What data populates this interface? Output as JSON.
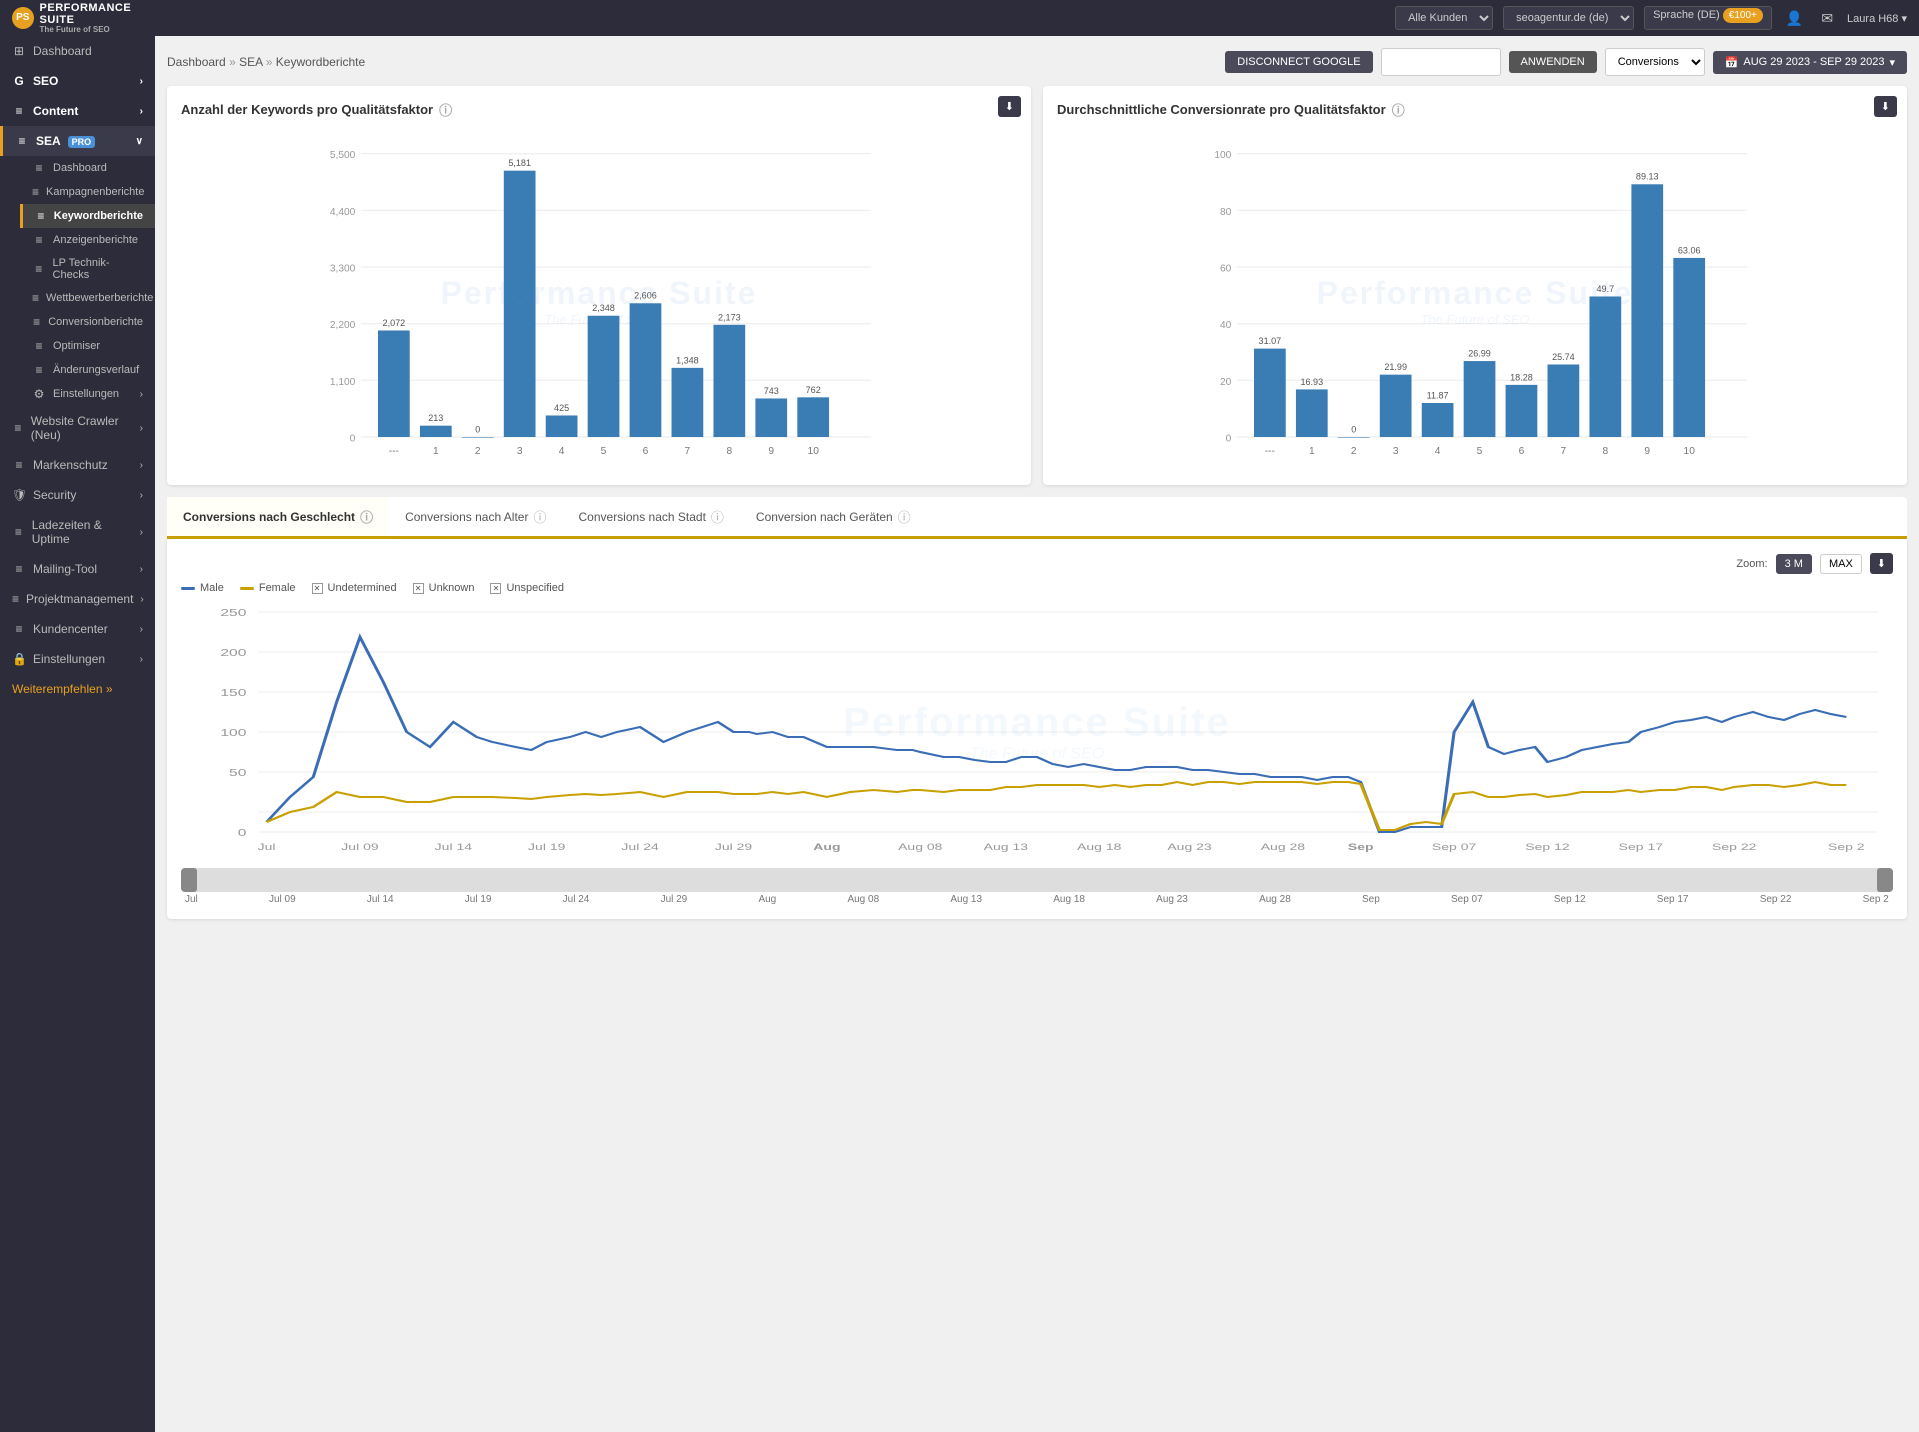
{
  "app": {
    "name": "PerforMance Suite",
    "tagline": "The Future of SEO"
  },
  "topnav": {
    "customer_label": "Alle Kunden",
    "agency_label": "seoagentur.de (de)",
    "language_label": "Sprache (DE)",
    "lang_badge": "€100+",
    "user_name": "Laura H68 ▾"
  },
  "breadcrumb": {
    "items": [
      "Dashboard",
      "SEA",
      "Keywordberichte"
    ],
    "separator": "»"
  },
  "toolbar": {
    "disconnect_label": "DISCONNECT GOOGLE",
    "apply_label": "ANWENDEN",
    "search_placeholder": "",
    "dropdown_options": [
      "Conversions"
    ],
    "dropdown_value": "Conversions",
    "date_range": "AUG 29 2023 - SEP 29 2023",
    "calendar_icon": "📅"
  },
  "sidebar": {
    "logo_icon": "PS",
    "items": [
      {
        "id": "dashboard",
        "label": "Dashboard",
        "icon": "⊞",
        "level": 0,
        "active": false
      },
      {
        "id": "seo",
        "label": "SEO",
        "icon": "G",
        "level": 0,
        "active": false,
        "hasArrow": true
      },
      {
        "id": "content",
        "label": "Content",
        "icon": "≡",
        "level": 0,
        "active": false,
        "hasArrow": true
      },
      {
        "id": "sea",
        "label": "SEA",
        "icon": "≡",
        "level": 0,
        "active": true,
        "hasArrow": true,
        "badge": "PRO"
      },
      {
        "id": "sea-dashboard",
        "label": "Dashboard",
        "icon": "≡",
        "level": 1,
        "active": false
      },
      {
        "id": "kampagnenberichte",
        "label": "Kampagnenberichte",
        "icon": "≡",
        "level": 1,
        "active": false
      },
      {
        "id": "keywordberichte",
        "label": "Keywordberichte",
        "icon": "≡",
        "level": 1,
        "active": true
      },
      {
        "id": "anzeigenberichte",
        "label": "Anzeigenberichte",
        "icon": "≡",
        "level": 1,
        "active": false
      },
      {
        "id": "lp-technik",
        "label": "LP Technik-Checks",
        "icon": "≡",
        "level": 1,
        "active": false
      },
      {
        "id": "wettbewerber",
        "label": "Wettbewerberberichte",
        "icon": "≡",
        "level": 1,
        "active": false
      },
      {
        "id": "conversionberichte",
        "label": "Conversionberichte",
        "icon": "≡",
        "level": 1,
        "active": false
      },
      {
        "id": "optimiser",
        "label": "Optimiser",
        "icon": "≡",
        "level": 1,
        "active": false
      },
      {
        "id": "aenderungsverlauf",
        "label": "Änderungsverlauf",
        "icon": "≡",
        "level": 1,
        "active": false
      },
      {
        "id": "einstellungen-sea",
        "label": "Einstellungen",
        "icon": "⚙",
        "level": 1,
        "active": false
      },
      {
        "id": "website-crawler",
        "label": "Website Crawler (Neu)",
        "icon": "≡",
        "level": 0,
        "active": false,
        "hasArrow": true
      },
      {
        "id": "markenschutz",
        "label": "Markenschutz",
        "icon": "≡",
        "level": 0,
        "active": false,
        "hasArrow": true
      },
      {
        "id": "security",
        "label": "Security",
        "icon": "🛡",
        "level": 0,
        "active": false,
        "hasArrow": true
      },
      {
        "id": "ladezeiten",
        "label": "Ladezeiten & Uptime",
        "icon": "≡",
        "level": 0,
        "active": false,
        "hasArrow": true
      },
      {
        "id": "mailing",
        "label": "Mailing-Tool",
        "icon": "≡",
        "level": 0,
        "active": false,
        "hasArrow": true
      },
      {
        "id": "projektmgmt",
        "label": "Projektmanagement",
        "icon": "≡",
        "level": 0,
        "active": false,
        "hasArrow": true
      },
      {
        "id": "kundencenter",
        "label": "Kundencenter",
        "icon": "≡",
        "level": 0,
        "active": false,
        "hasArrow": true
      },
      {
        "id": "einstellungen",
        "label": "Einstellungen",
        "icon": "🔒",
        "level": 0,
        "active": false,
        "hasArrow": true
      }
    ],
    "recommend_label": "Weiterempfehlen »"
  },
  "chart1": {
    "title": "Anzahl der Keywords pro Qualitätsfaktor",
    "watermark_title": "Performance Suite",
    "watermark_sub": "The Future of SEO",
    "bars": [
      {
        "x": "---",
        "value": 2072,
        "label": "2,072"
      },
      {
        "x": "1",
        "value": 213,
        "label": "213"
      },
      {
        "x": "2",
        "value": 0,
        "label": "0"
      },
      {
        "x": "3",
        "value": 5181,
        "label": "5,181"
      },
      {
        "x": "4",
        "value": 425,
        "label": "425"
      },
      {
        "x": "5",
        "value": 2348,
        "label": "2,348"
      },
      {
        "x": "6",
        "value": 2606,
        "label": "2,606"
      },
      {
        "x": "7",
        "value": 1348,
        "label": "1,348"
      },
      {
        "x": "8",
        "value": 2173,
        "label": "2,173"
      },
      {
        "x": "9",
        "value": 743,
        "label": "743"
      },
      {
        "x": "10",
        "value": 762,
        "label": "762"
      }
    ],
    "max_value": 5500,
    "download_icon": "⬇"
  },
  "chart2": {
    "title": "Durchschnittliche Conversionrate pro Qualitätsfaktor",
    "watermark_title": "Performance Suite",
    "watermark_sub": "The Future of SEO",
    "bars": [
      {
        "x": "---",
        "value": 31.07,
        "label": "31.07"
      },
      {
        "x": "1",
        "value": 16.93,
        "label": "16.93"
      },
      {
        "x": "2",
        "value": 0,
        "label": "0"
      },
      {
        "x": "3",
        "value": 21.99,
        "label": "21.99"
      },
      {
        "x": "4",
        "value": 11.87,
        "label": "11.87"
      },
      {
        "x": "5",
        "value": 26.99,
        "label": "26.99"
      },
      {
        "x": "6",
        "value": 18.28,
        "label": "18.28"
      },
      {
        "x": "7",
        "value": 25.74,
        "label": "25.74"
      },
      {
        "x": "8",
        "value": 49.7,
        "label": "49.7"
      },
      {
        "x": "9",
        "value": 89.13,
        "label": "89.13"
      },
      {
        "x": "10",
        "value": 63.06,
        "label": "63.06"
      }
    ],
    "max_value": 100,
    "download_icon": "⬇"
  },
  "tabs": [
    {
      "id": "geschlecht",
      "label": "Conversions nach Geschlecht",
      "active": true
    },
    {
      "id": "alter",
      "label": "Conversions nach Alter",
      "active": false
    },
    {
      "id": "stadt",
      "label": "Conversions nach Stadt",
      "active": false
    },
    {
      "id": "geraete",
      "label": "Conversion nach Geräten",
      "active": false
    }
  ],
  "line_chart": {
    "title": "Conversions nach Geschlecht",
    "zoom_options": [
      "3 M",
      "MAX"
    ],
    "zoom_active": "3 M",
    "legend": [
      {
        "id": "male",
        "label": "Male",
        "color": "#3a6db5",
        "type": "solid"
      },
      {
        "id": "female",
        "label": "Female",
        "color": "#c8a000",
        "type": "solid"
      },
      {
        "id": "undetermined",
        "label": "Undetermined",
        "color": "#999",
        "type": "cross",
        "checked": true
      },
      {
        "id": "unknown",
        "label": "Unknown",
        "color": "#999",
        "type": "cross",
        "checked": true
      },
      {
        "id": "unspecified",
        "label": "Unspecified",
        "color": "#999",
        "type": "cross",
        "checked": true
      }
    ],
    "y_labels": [
      "0",
      "50",
      "100",
      "150",
      "200",
      "250"
    ],
    "x_labels": [
      "Jul",
      "Jul 09",
      "Jul 14",
      "Jul 19",
      "Jul 24",
      "Jul 29",
      "Aug",
      "Aug 08",
      "Aug 13",
      "Aug 18",
      "Aug 23",
      "Aug 28",
      "Sep",
      "Sep 07",
      "Sep 12",
      "Sep 17",
      "Sep 22",
      "Sep 2"
    ],
    "download_icon": "⬇",
    "watermark_title": "Performance Suite",
    "watermark_sub": "The Future of SEO"
  }
}
